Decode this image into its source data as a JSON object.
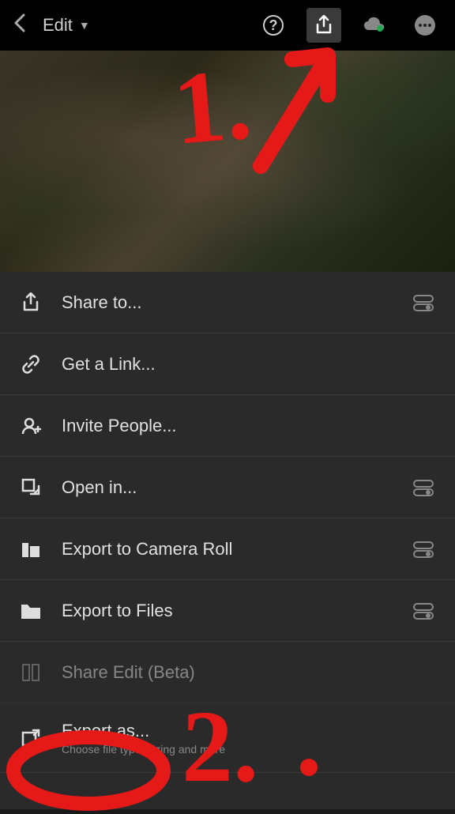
{
  "header": {
    "title": "Edit"
  },
  "menu": {
    "share_to": "Share to...",
    "get_link": "Get a Link...",
    "invite_people": "Invite People...",
    "open_in": "Open in...",
    "export_camera_roll": "Export to Camera Roll",
    "export_files": "Export to Files",
    "share_edit": "Share Edit (Beta)",
    "export_as": "Export as...",
    "export_as_sub": "Choose file type, sizing and more"
  },
  "annotations": {
    "step1": "1.",
    "step2": "2."
  }
}
